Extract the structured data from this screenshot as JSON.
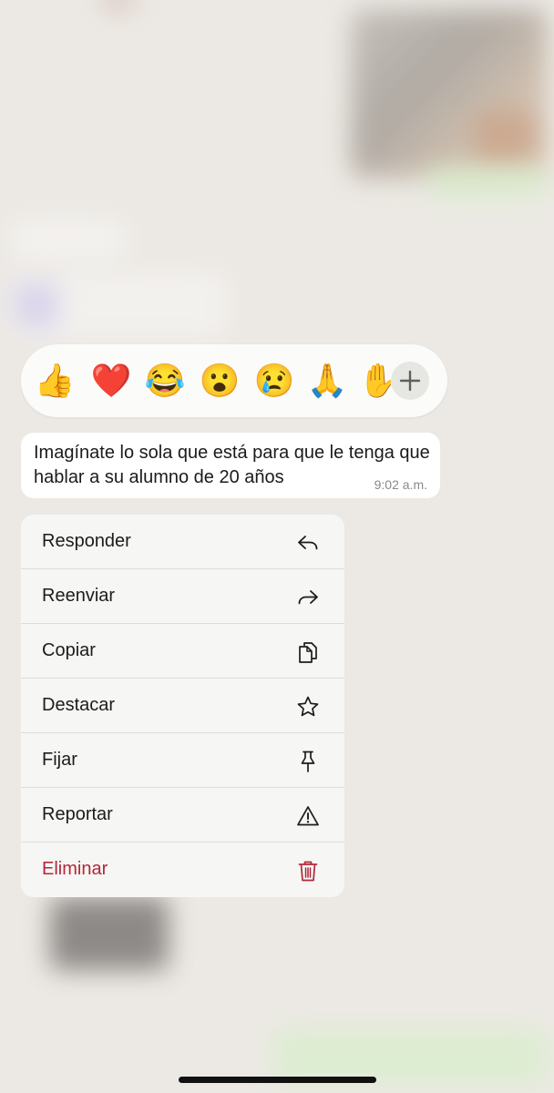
{
  "reactions": [
    {
      "emoji": "👍",
      "icon": "thumbs-up-icon"
    },
    {
      "emoji": "❤️",
      "icon": "heart-icon"
    },
    {
      "emoji": "😂",
      "icon": "tears-of-joy-icon"
    },
    {
      "emoji": "😮",
      "icon": "surprised-face-icon"
    },
    {
      "emoji": "😢",
      "icon": "crying-face-icon"
    },
    {
      "emoji": "🙏",
      "icon": "folded-hands-icon"
    },
    {
      "emoji": "✋",
      "icon": "raised-hand-icon"
    }
  ],
  "more_reactions_icon": "plus-icon",
  "message": {
    "text": "Imagínate lo sola que está para que le tenga que hablar a su alumno de 20 años",
    "time": "9:02 a.m."
  },
  "menu": {
    "items": [
      {
        "label": "Responder",
        "icon": "reply-icon"
      },
      {
        "label": "Reenviar",
        "icon": "forward-icon"
      },
      {
        "label": "Copiar",
        "icon": "copy-icon"
      },
      {
        "label": "Destacar",
        "icon": "star-icon"
      },
      {
        "label": "Fijar",
        "icon": "pin-icon"
      },
      {
        "label": "Reportar",
        "icon": "warning-icon"
      },
      {
        "label": "Eliminar",
        "icon": "trash-icon"
      }
    ]
  },
  "colors": {
    "danger": "#b1283a",
    "background": "#ece9e4",
    "menu_background": "#f6f6f4"
  }
}
